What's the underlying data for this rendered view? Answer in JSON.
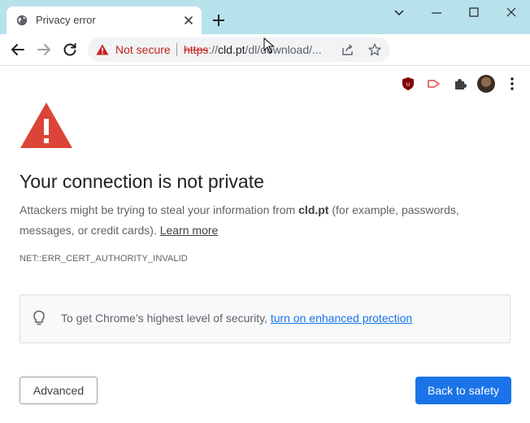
{
  "browser": {
    "tab_title": "Privacy error",
    "security_label": "Not secure",
    "url_scheme": "https",
    "url_rest_prefix": "://",
    "url_host": "cld.pt",
    "url_path": "/dl/download/...",
    "icons": [
      "globe-icon",
      "close-icon",
      "plus-icon",
      "chevron-down-icon",
      "minimize-icon",
      "maximize-icon",
      "close-window-icon",
      "back-arrow-icon",
      "forward-arrow-icon",
      "reload-icon",
      "warning-triangle-icon",
      "share-icon",
      "star-icon",
      "shield-extension-icon",
      "arrow-extension-icon",
      "puzzle-icon",
      "avatar",
      "kebab-menu-icon"
    ]
  },
  "page": {
    "heading": "Your connection is not private",
    "desc_prefix": "Attackers might be trying to steal your information from ",
    "desc_host": "cld.pt",
    "desc_suffix": " (for example, passwords, messages, or credit cards). ",
    "learn_more": "Learn more",
    "error_code": "NET::ERR_CERT_AUTHORITY_INVALID",
    "promo_prefix": "To get Chrome’s highest level of security, ",
    "promo_link": "turn on enhanced protection",
    "advanced_button": "Advanced",
    "back_button": "Back to safety"
  },
  "colors": {
    "titlebar": "#b7e2ec",
    "danger": "#d93025",
    "primary": "#1a73e8"
  }
}
